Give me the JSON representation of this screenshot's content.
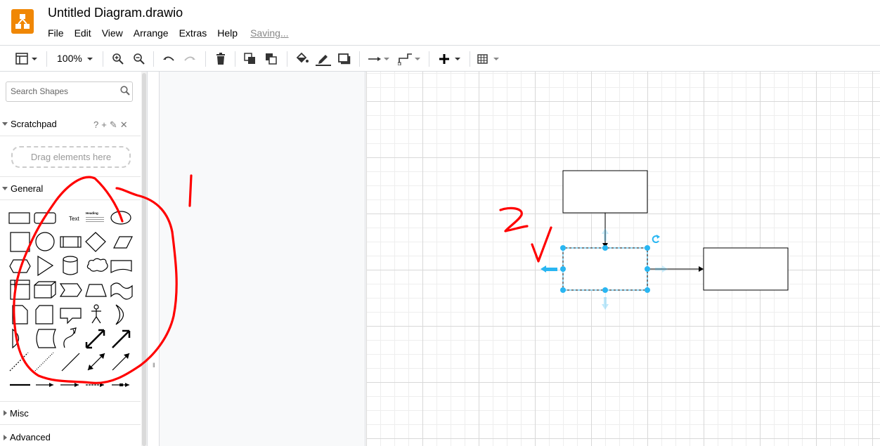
{
  "app": {
    "title": "Untitled Diagram.drawio",
    "menu": [
      "File",
      "Edit",
      "View",
      "Arrange",
      "Extras",
      "Help"
    ],
    "status": "Saving..."
  },
  "toolbar": {
    "zoom": "100%",
    "icons": [
      "panel-layout-icon",
      "zoom-in-icon",
      "zoom-out-icon",
      "undo-icon",
      "redo-icon",
      "delete-icon",
      "to-front-icon",
      "to-back-icon",
      "fill-color-icon",
      "line-color-icon",
      "shadow-icon",
      "connection-icon",
      "waypoints-icon",
      "insert-icon",
      "table-icon"
    ]
  },
  "sidebar": {
    "search_placeholder": "Search Shapes",
    "scratchpad": {
      "label": "Scratchpad",
      "tools": "?+✎✕",
      "drop_hint": "Drag elements here"
    },
    "general": {
      "label": "General",
      "text_shape": "Text",
      "heading_shape": "Heading"
    },
    "sections_collapsed": [
      "Misc",
      "Advanced"
    ]
  },
  "annotations": {
    "mark_1": "1",
    "mark_2": "2",
    "mark_3": "V",
    "color": "#ff0000"
  },
  "colors": {
    "selection": "#29b6f2",
    "brand": "#f08705"
  }
}
